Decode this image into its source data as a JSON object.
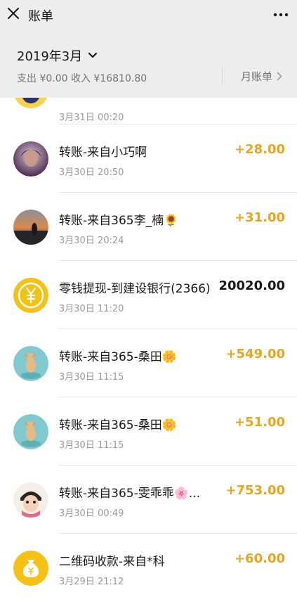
{
  "topbar": {
    "title": "账单"
  },
  "header": {
    "month": "2019年3月",
    "summary": "支出 ¥0.00 收入 ¥16810.80",
    "monthly_bill": "月账单"
  },
  "colors": {
    "income": "#e9a51c",
    "background": "#ededed",
    "wechat_yellow": "#f5c115"
  },
  "transactions": [
    {
      "title": "",
      "time": "3月31日 00:20",
      "amount": "",
      "icon": "avatar"
    },
    {
      "title": "转账-来自小巧啊",
      "time": "3月30日 20:50",
      "amount": "+28.00",
      "icon": "avatar"
    },
    {
      "title": "转账-来自365李_楠🌻",
      "time": "3月30日 20:24",
      "amount": "+31.00",
      "icon": "avatar"
    },
    {
      "title": "零钱提现-到建设银行(2366)",
      "time": "3月30日 11:20",
      "amount": "20020.00",
      "icon": "yuan-coin-icon"
    },
    {
      "title": "转账-来自365-桑田🌼",
      "time": "3月30日 11:15",
      "amount": "+549.00",
      "icon": "avatar"
    },
    {
      "title": "转账-来自365-桑田🌼",
      "time": "3月30日 11:15",
      "amount": "+51.00",
      "icon": "avatar"
    },
    {
      "title": "转账-来自365-雯乖乖🌸...",
      "time": "3月30日 00:49",
      "amount": "+753.00",
      "icon": "avatar"
    },
    {
      "title": "二维码收款-来自*科",
      "time": "3月29日 21:12",
      "amount": "+60.00",
      "icon": "money-bag-icon"
    }
  ]
}
